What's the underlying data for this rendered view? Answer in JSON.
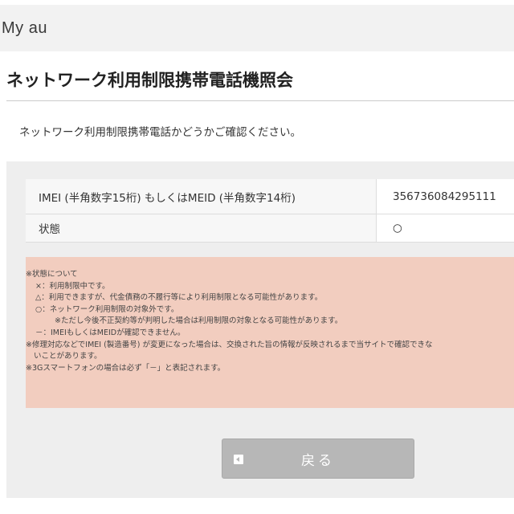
{
  "header": {
    "brand": "My au"
  },
  "page": {
    "title": "ネットワーク利用制限携帯電話機照会",
    "intro": "ネットワーク利用制限携帯電話かどうかご確認ください。"
  },
  "result": {
    "imei_label": "IMEI (半角数字15桁) もしくはMEID (半角数字14桁)",
    "imei_value": "356736084295111",
    "status_label": "状態",
    "status_value": "○"
  },
  "notes": [
    "※状態について",
    "×：利用制限中です。",
    "△：利用できますが、代金債務の不履行等により利用制限となる可能性があります。",
    "○：ネットワーク利用制限の対象外です。",
    "※ただし今後不正契約等が判明した場合は利用制限の対象となる可能性があります。",
    "－：IMEIもしくはMEIDが確認できません。",
    "※修理対応などでIMEI (製造番号) が変更になった場合は、交換された旨の情報が反映されるまで当サイトで確認できな",
    "いことがあります。",
    "※3Gスマートフォンの場合は必ず「－」と表記されます。"
  ],
  "actions": {
    "back_label": "戻る"
  }
}
